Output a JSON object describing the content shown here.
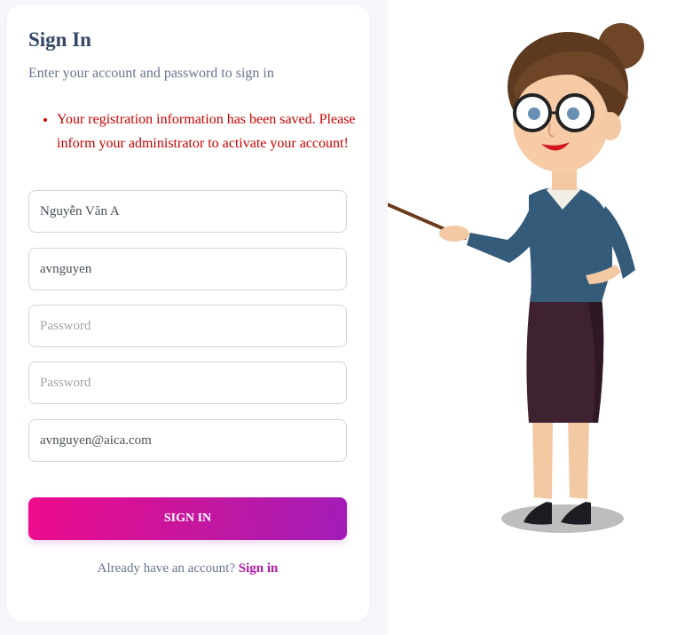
{
  "card": {
    "title": "Sign In",
    "subtitle": "Enter your account and password to sign in"
  },
  "messages": [
    "Your registration information has been saved. Please inform your administrator to activate your account!"
  ],
  "form": {
    "fullname_value": "Nguyễn Văn A",
    "username_value": "avnguyen",
    "password_placeholder": "Password",
    "confirm_password_placeholder": "Password",
    "email_value": "avnguyen@aica.com",
    "submit_label": "SIGN IN"
  },
  "footer": {
    "prompt": "Already have an account?",
    "link_label": "Sign in"
  },
  "colors": {
    "accent_start": "#ee0b8c",
    "accent_end": "#a21cb8",
    "error": "#cc0000",
    "title": "#344767"
  },
  "illustration": {
    "name": "teacher-with-pointer-illustration"
  }
}
